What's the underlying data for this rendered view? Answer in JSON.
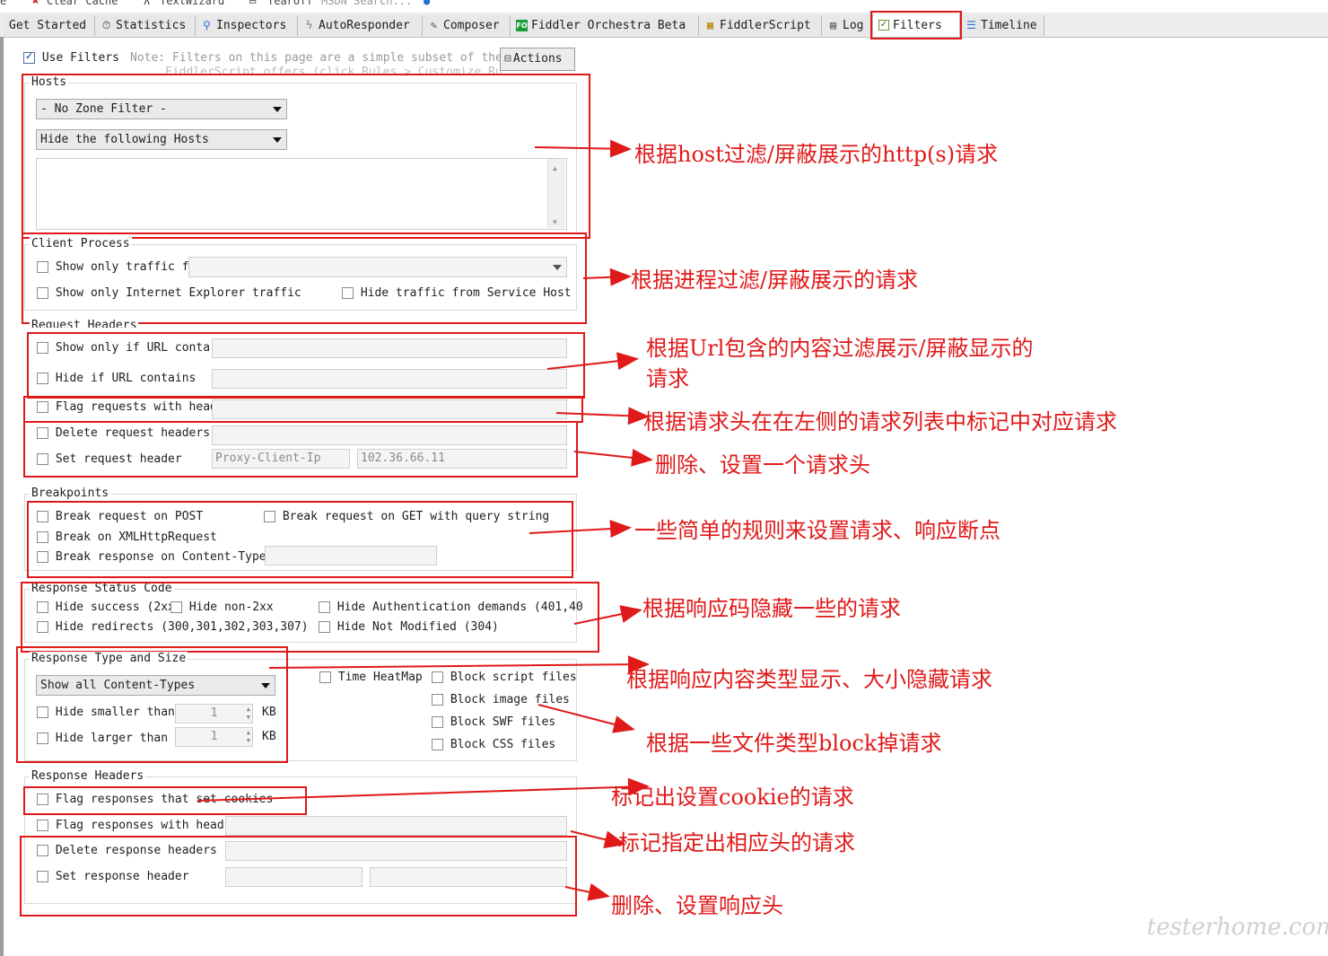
{
  "topstrip": [
    "e",
    "Clear Cache",
    "TextWizard",
    "Tearoff",
    "MSDN Search..."
  ],
  "tabs": [
    {
      "label": "Get Started",
      "icon": "none"
    },
    {
      "label": "Statistics",
      "icon": "stopwatch-icon"
    },
    {
      "label": "Inspectors",
      "icon": "magnifier-icon"
    },
    {
      "label": "AutoResponder",
      "icon": "lightning-icon"
    },
    {
      "label": "Composer",
      "icon": "pencil-icon"
    },
    {
      "label": "Fiddler Orchestra Beta",
      "icon": "fo-icon"
    },
    {
      "label": "FiddlerScript",
      "icon": "script-icon"
    },
    {
      "label": "Log",
      "icon": "log-icon"
    },
    {
      "label": "Filters",
      "icon": "checkbox-icon"
    },
    {
      "label": "Timeline",
      "icon": "timeline-icon"
    }
  ],
  "fo_badge": "FO",
  "filters": {
    "use_filters": "Use Filters",
    "note_line1": "Note: Filters on this page are a simple subset of the",
    "note_line2": "FiddlerScript offers (click Rules > Customize Ru",
    "actions": "Actions",
    "hosts": {
      "title": "Hosts",
      "zone_filter": "- No Zone Filter -",
      "host_mode": "Hide the following Hosts"
    },
    "client_process": {
      "title": "Client Process",
      "show_only_traffic": "Show only traffic f",
      "show_only_ie": "Show only Internet Explorer traffic",
      "hide_service_host": "Hide traffic from Service Host"
    },
    "request_headers": {
      "title": "Request Headers",
      "show_if_url": "Show only if URL conta",
      "hide_if_url": "Hide if URL contains",
      "flag_requests": "Flag requests with head",
      "delete_request_headers": "Delete request headers",
      "set_request_header": "Set request header",
      "set_header_name_placeholder": "Proxy-Client-Ip",
      "set_header_value_placeholder": "102.36.66.11"
    },
    "breakpoints": {
      "title": "Breakpoints",
      "break_post": "Break request on POST",
      "break_get": "Break request on GET with query string",
      "break_xhr": "Break on XMLHttpRequest",
      "break_content_type": "Break response on Content-Type"
    },
    "status_code": {
      "title": "Response Status Code",
      "hide_success": "Hide success (2xx",
      "hide_non2xx": "Hide non-2xx",
      "hide_auth": "Hide Authentication demands (401,40",
      "hide_redirects": "Hide redirects (300,301,302,303,307)",
      "hide_not_modified": "Hide Not Modified (304)"
    },
    "type_size": {
      "title": "Response Type and Size",
      "content_types": "Show all Content-Types",
      "time_heatmap": "Time HeatMap",
      "block_script": "Block script files",
      "block_image": "Block image files",
      "block_swf": "Block SWF files",
      "block_css": "Block CSS files",
      "hide_smaller": "Hide smaller than",
      "hide_larger": "Hide larger than",
      "smaller_value": "1",
      "larger_value": "1",
      "unit": "KB"
    },
    "response_headers": {
      "title": "Response Headers",
      "flag_cookies": "Flag responses that set cookies",
      "flag_with_head": "Flag responses with head",
      "delete_response_headers": "Delete response headers",
      "set_response_header": "Set response header"
    }
  },
  "annotations": {
    "hosts": "根据host过滤/屏蔽展示的http(s)请求",
    "process": "根据进程过滤/屏蔽展示的请求",
    "url_line1": "根据Url包含的内容过滤展示/屏蔽显示的",
    "url_line2": "请求",
    "flag_request": "根据请求头在在左侧的请求列表中标记中对应请求",
    "set_request": "删除、设置一个请求头",
    "breakpoints": "一些简单的规则来设置请求、响应断点",
    "status": "根据响应码隐藏一些的请求",
    "type_size": "根据响应内容类型显示、大小隐藏请求",
    "block": "根据一些文件类型block掉请求",
    "cookie": "标记出设置cookie的请求",
    "resp_head": "标记指定出相应头的请求",
    "set_response": "删除、设置响应头"
  },
  "watermark": "testerhome.com",
  "colors": {
    "annotation_red": "#e01919",
    "tab_bg": "#ededed",
    "field_bg": "#f4f4f4"
  }
}
